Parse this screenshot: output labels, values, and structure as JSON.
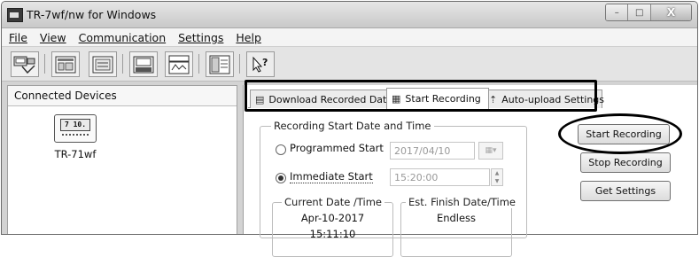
{
  "window": {
    "title": "TR-7wf/nw for Windows",
    "controls": {
      "minimize": "–",
      "maximize": "□",
      "close": "X"
    }
  },
  "menu": [
    {
      "label": "File"
    },
    {
      "label": "View"
    },
    {
      "label": "Communication"
    },
    {
      "label": "Settings"
    },
    {
      "label": "Help"
    }
  ],
  "toolbar": {
    "buttons": [
      {
        "icon": "download-device-icon"
      },
      {
        "icon": "graph-view-icon"
      },
      {
        "icon": "device-settings-icon"
      },
      {
        "icon": "start-recording-icon"
      },
      {
        "icon": "current-readings-icon"
      },
      {
        "icon": "table-view-icon"
      },
      {
        "icon": "help-pointer-icon"
      }
    ]
  },
  "left_pane": {
    "header": "Connected Devices",
    "device": {
      "name": "TR-71wf",
      "screen": "7 10."
    }
  },
  "tabs": [
    {
      "label": "Download Recorded Data",
      "icon": "download-tab-icon",
      "active": false
    },
    {
      "label": "Start Recording",
      "icon": "start-recording-tab-icon",
      "active": true
    },
    {
      "label": "Auto-upload Settings",
      "icon": "auto-upload-tab-icon",
      "active": false
    }
  ],
  "recording": {
    "group_title": "Recording Start Date and Time",
    "programmed_label": "Programmed Start",
    "programmed_date": "2017/04/10",
    "immediate_label": "Immediate Start",
    "immediate_time": "15:20:00",
    "selected_option": "Immediate Start",
    "current_title": "Current Date /Time",
    "current_date": "Apr-10-2017",
    "current_time_partial": "15:11:10",
    "finish_title": "Est. Finish Date/Time",
    "finish_value": "Endless"
  },
  "buttons": {
    "start": "Start Recording",
    "stop": "Stop Recording",
    "get": "Get Settings"
  },
  "annotations": {
    "tab_highlight": true,
    "start_button_circled": true
  }
}
